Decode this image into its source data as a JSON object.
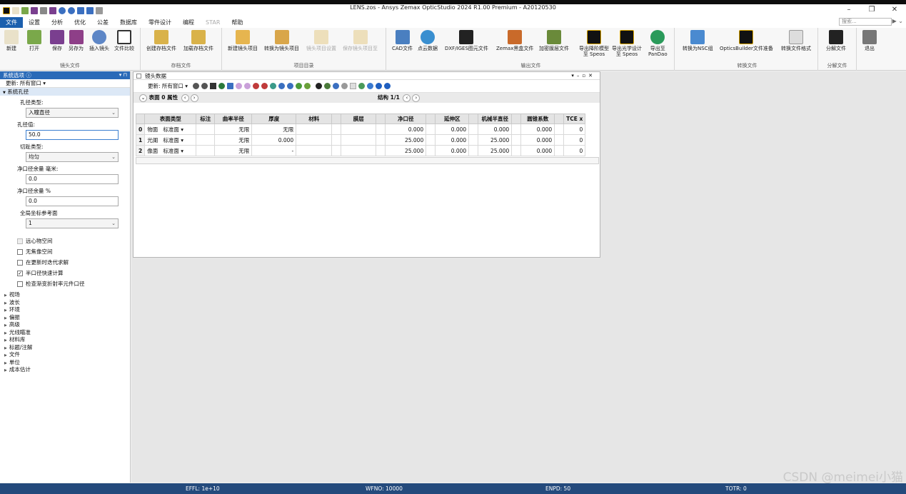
{
  "window": {
    "title": "LENS.zos - Ansys Zemax OpticStudio 2024 R1.00   Premium - A20120530"
  },
  "menu": {
    "tabs": [
      {
        "label": "文件",
        "active": true
      },
      {
        "label": "设置"
      },
      {
        "label": "分析"
      },
      {
        "label": "优化"
      },
      {
        "label": "公差"
      },
      {
        "label": "数据库"
      },
      {
        "label": "零件设计"
      },
      {
        "label": "编程"
      },
      {
        "label": "STAR",
        "disabled": true
      },
      {
        "label": "帮助"
      }
    ],
    "search_placeholder": "搜索..."
  },
  "ribbon": {
    "groups": [
      {
        "label": "镜头文件",
        "buttons": [
          {
            "label": "新建",
            "icon": "new-file-icon",
            "color": "#e9e1c9"
          },
          {
            "label": "打开",
            "icon": "open-folder-icon",
            "color": "#7aa84a"
          },
          {
            "label": "保存",
            "icon": "save-icon",
            "color": "#7a3f8f"
          },
          {
            "label": "另存为",
            "icon": "save-as-icon",
            "color": "#8e3f88"
          },
          {
            "label": "插入镜头",
            "icon": "insert-lens-icon",
            "color": "#5d86c6"
          },
          {
            "label": "文件比较",
            "icon": "file-compare-icon",
            "color": "#333333"
          }
        ]
      },
      {
        "label": "存档文件",
        "buttons": [
          {
            "label": "创建存档文件",
            "icon": "create-archive-icon",
            "color": "#d9b24a"
          },
          {
            "label": "加载存档文件",
            "icon": "load-archive-icon",
            "color": "#d9b24a"
          }
        ]
      },
      {
        "label": "项目目录",
        "buttons": [
          {
            "label": "新建镜头项目",
            "icon": "new-project-icon",
            "color": "#e6b54f"
          },
          {
            "label": "转换为镜头项目",
            "icon": "convert-project-icon",
            "color": "#d9a64a"
          },
          {
            "label": "镜头项目设置",
            "icon": "project-settings-icon",
            "color": "#d9b24a",
            "disabled": true
          },
          {
            "label": "保存镜头项目至",
            "icon": "save-project-icon",
            "color": "#d9b24a",
            "disabled": true
          }
        ]
      },
      {
        "label": "输出文件",
        "buttons": [
          {
            "label": "CAD文件",
            "icon": "cad-file-icon",
            "color": "#4a7fc0"
          },
          {
            "label": "点云数据",
            "icon": "point-cloud-icon",
            "color": "#3a8fd0"
          },
          {
            "label": "DXF/IGES图元文件",
            "icon": "dxf-file-icon",
            "color": "#222222"
          },
          {
            "label": "Zemax黑盒文件",
            "icon": "blackbox-icon",
            "color": "#c96a2a"
          },
          {
            "label": "加密膜层文件",
            "icon": "encrypted-coating-icon",
            "color": "#6a8a3a"
          },
          {
            "label": "导出降阶模型\n至 Speos",
            "icon": "speos-export-icon",
            "color": "#111111"
          },
          {
            "label": "导出光学设计\n至 Speos",
            "icon": "speos-design-icon",
            "color": "#111111"
          },
          {
            "label": "导出至\nPanDao",
            "icon": "pandao-icon",
            "color": "#2a9a5a"
          }
        ]
      },
      {
        "label": "转换文件",
        "buttons": [
          {
            "label": "转换为NSC组",
            "icon": "convert-nsc-icon",
            "color": "#4a8ad0"
          },
          {
            "label": "OpticsBuilder文件准备",
            "icon": "opticsbuilder-icon",
            "color": "#111111"
          },
          {
            "label": "转换文件格式",
            "icon": "convert-format-icon",
            "color": "#dddddd"
          }
        ]
      },
      {
        "label": "分解文件",
        "buttons": [
          {
            "label": "分解文件",
            "icon": "split-file-icon",
            "color": "#222222"
          }
        ]
      },
      {
        "label": "",
        "buttons": [
          {
            "label": "退出",
            "icon": "exit-icon",
            "color": "#777777"
          }
        ]
      }
    ]
  },
  "left_panel": {
    "title": "系统选项 ⓘ",
    "update": "更新: 所有窗口 ▾",
    "section": "系统孔径",
    "aperture_type_label": "孔径类型:",
    "aperture_type_value": "入瞳直径",
    "aperture_value_label": "孔径值:",
    "aperture_value": "50.0",
    "apodization_label": "切趾类型:",
    "apodization_value": "均匀",
    "clear_margin_mm_label": "净口径余量 毫米:",
    "clear_margin_mm": "0.0",
    "clear_margin_pct_label": "净口径余量 %",
    "clear_margin_pct": "0.0",
    "global_ref_label": "全局坐标参考面",
    "global_ref_value": "1",
    "checkboxes": [
      {
        "label": "远心物空间",
        "checked": false,
        "disabled": true
      },
      {
        "label": "无焦像空间",
        "checked": false
      },
      {
        "label": "在更新时迭代求解",
        "checked": false
      },
      {
        "label": "半口径快速计算",
        "checked": true
      },
      {
        "label": "检查渐变折射率元件口径",
        "checked": false
      }
    ],
    "tree": [
      "视场",
      "波长",
      "环境",
      "偏振",
      "高级",
      "光线瞄准",
      "材料库",
      "标题/注解",
      "文件",
      "单位",
      "成本估计"
    ]
  },
  "lens_editor": {
    "title": "镜头数据",
    "update": "更新: 所有窗口 ▾",
    "nav_left": "表面  0 属性",
    "nav_center": "结构 1/1",
    "columns": [
      "表面类型",
      "标注",
      "曲率半径",
      "厚度",
      "材料",
      "",
      "膜层",
      "",
      "净口径",
      "",
      "延伸区",
      "",
      "机械半直径",
      "",
      "圆锥系数",
      "",
      "TCE x"
    ],
    "rows": [
      {
        "idx": "0",
        "name": "物面",
        "type": "标准面 ▾",
        "radius": "无限",
        "thickness": "无限",
        "clear": "0.000",
        "chip": "0.000",
        "mech": "0.000",
        "conic": "0.000",
        "tce": "0"
      },
      {
        "idx": "1",
        "name": "光阑",
        "type": "标准面 ▾",
        "radius": "无限",
        "thickness": "0.000",
        "clear": "25.000",
        "chip": "0.000",
        "mech": "25.000",
        "conic": "0.000",
        "tce": "0"
      },
      {
        "idx": "2",
        "name": "像面",
        "type": "标准面 ▾",
        "radius": "无限",
        "thickness": "-",
        "clear": "25.000",
        "chip": "0.000",
        "mech": "25.000",
        "conic": "0.000",
        "tce": "0"
      }
    ]
  },
  "status": {
    "effl": "EFFL: 1e+10",
    "wfno": "WFNO: 10000",
    "enpd": "ENPD: 50",
    "totr": "TOTR: 0"
  },
  "watermark": "CSDN @meimei小猫"
}
